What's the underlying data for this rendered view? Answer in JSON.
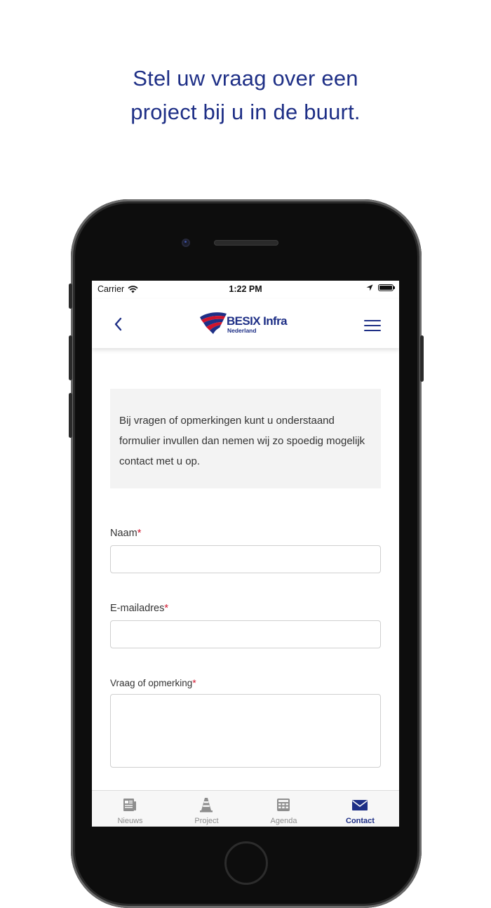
{
  "headline": {
    "line1": "Stel uw vraag over een",
    "line2": "project bij u in de buurt."
  },
  "status_bar": {
    "carrier": "Carrier",
    "time": "1:22 PM"
  },
  "nav": {
    "back_icon": "chevron-left-icon",
    "menu_icon": "hamburger-menu-icon",
    "logo_name": "BESIX Infra",
    "logo_sub": "Nederland"
  },
  "form": {
    "intro": "Bij vragen of opmerkingen kunt u onderstaand formulier invullen dan nemen wij zo spoedig mogelijk contact met u op.",
    "name_label": "Naam",
    "email_label": "E-mailadres",
    "question_label": "Vraag of opmerking",
    "required_marker": "*",
    "name_value": "",
    "email_value": "",
    "question_value": ""
  },
  "tabs": [
    {
      "label": "Nieuws",
      "icon": "newspaper-icon"
    },
    {
      "label": "Project",
      "icon": "traffic-cone-icon"
    },
    {
      "label": "Agenda",
      "icon": "calendar-grid-icon"
    },
    {
      "label": "Contact",
      "icon": "envelope-icon"
    }
  ],
  "active_tab": "Contact",
  "colors": {
    "brand_blue": "#1e2f86",
    "brand_red": "#d0142c",
    "inactive_gray": "#8e8e8e"
  }
}
